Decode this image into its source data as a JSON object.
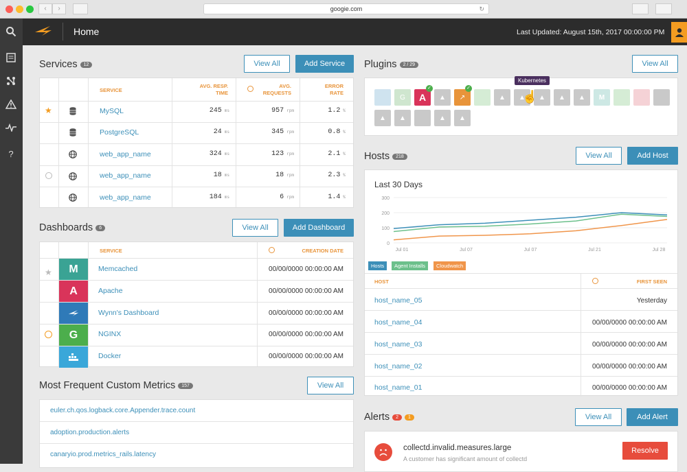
{
  "browser": {
    "url": "googie.com"
  },
  "topbar": {
    "title": "Home",
    "last_updated": "Last Updated: August 15th, 2017 00:00:00 PM"
  },
  "services": {
    "title": "Services",
    "count": "12",
    "view_all": "View All",
    "add": "Add Service",
    "headers": {
      "service": "SERVICE",
      "resp": "AVG. RESP. TIME",
      "req": "AVG. REQUESTS",
      "err": "ERROR RATE"
    },
    "rows": [
      {
        "name": "MySQL",
        "resp": "245",
        "resp_unit": "ms",
        "req": "957",
        "req_unit": "rpm",
        "err": "1.2",
        "err_unit": "%"
      },
      {
        "name": "PostgreSQL",
        "resp": "24",
        "resp_unit": "ms",
        "req": "345",
        "req_unit": "rpm",
        "err": "0.8",
        "err_unit": "%"
      },
      {
        "name": "web_app_name",
        "resp": "324",
        "resp_unit": "ms",
        "req": "123",
        "req_unit": "rpm",
        "err": "2.1",
        "err_unit": "%"
      },
      {
        "name": "web_app_name",
        "resp": "18",
        "resp_unit": "ms",
        "req": "18",
        "req_unit": "rpm",
        "err": "2.3",
        "err_unit": "%"
      },
      {
        "name": "web_app_name",
        "resp": "184",
        "resp_unit": "ms",
        "req": "6",
        "req_unit": "rpm",
        "err": "1.4",
        "err_unit": "%"
      }
    ]
  },
  "dashboards": {
    "title": "Dashboards",
    "count": "6",
    "view_all": "View All",
    "add": "Add Dashboard",
    "headers": {
      "service": "SERVICE",
      "date": "CREATION DATE"
    },
    "rows": [
      {
        "name": "Memcached",
        "letter": "M",
        "color": "#3aa394",
        "date": "00/00/0000 00:00:00 AM"
      },
      {
        "name": "Apache",
        "letter": "A",
        "color": "#d9345a",
        "date": "00/00/0000 00:00:00 AM"
      },
      {
        "name": "Wynn's Dashboard",
        "letter": "",
        "color": "#2f7ab8",
        "date": "00/00/0000 00:00:00 AM"
      },
      {
        "name": "NGINX",
        "letter": "G",
        "color": "#4cae4c",
        "date": "00/00/0000 00:00:00 AM"
      },
      {
        "name": "Docker",
        "letter": "",
        "color": "#3aa7d9",
        "date": "00/00/0000 00:00:00 AM"
      }
    ]
  },
  "metrics": {
    "title": "Most Frequent Custom Metrics",
    "count": "157",
    "view_all": "View All",
    "items": [
      "euler.ch.qos.logback.core.Appender.trace.count",
      "adoption.production.alerts",
      "canaryio.prod.metrics_rails.latency"
    ]
  },
  "plugins": {
    "title": "Plugins",
    "count": "2 / 29",
    "view_all": "View All",
    "tooltip": "Kubernetes"
  },
  "hosts": {
    "title": "Hosts",
    "count": "218",
    "view_all": "View All",
    "add": "Add Host",
    "chart_title": "Last 30 Days",
    "legend": [
      "Hosts",
      "Agent Installs",
      "Cloudwatch"
    ],
    "headers": {
      "host": "HOST",
      "seen": "FIRST SEEN"
    },
    "rows": [
      {
        "name": "host_name_05",
        "seen": "Yesterday"
      },
      {
        "name": "host_name_04",
        "seen": "00/00/0000 00:00:00 AM"
      },
      {
        "name": "host_name_03",
        "seen": "00/00/0000 00:00:00 AM"
      },
      {
        "name": "host_name_02",
        "seen": "00/00/0000 00:00:00 AM"
      },
      {
        "name": "host_name_01",
        "seen": "00/00/0000 00:00:00 AM"
      }
    ]
  },
  "chart_data": {
    "type": "line",
    "title": "Last 30 Days",
    "x": [
      "Jul 01",
      "Jul 07",
      "Jul 07",
      "Jul 21",
      "Jul 28"
    ],
    "ylim": [
      0,
      300
    ],
    "yticks": [
      0,
      100,
      200,
      300
    ],
    "series": [
      {
        "name": "Hosts",
        "color": "#3c8fb8",
        "values": [
          95,
          120,
          130,
          150,
          170,
          200,
          185
        ]
      },
      {
        "name": "Agent Installs",
        "color": "#6cc08b",
        "values": [
          75,
          105,
          110,
          125,
          145,
          190,
          175
        ]
      },
      {
        "name": "Cloudwatch",
        "color": "#f0954a",
        "values": [
          20,
          45,
          50,
          60,
          80,
          115,
          155
        ]
      }
    ]
  },
  "alerts": {
    "title": "Alerts",
    "count_red": "2",
    "count_orange": "1",
    "view_all": "View All",
    "add": "Add Alert",
    "item": {
      "title": "collectd.invalid.measures.large",
      "desc": "A customer has significant amount of collectd",
      "action": "Resolve"
    }
  }
}
